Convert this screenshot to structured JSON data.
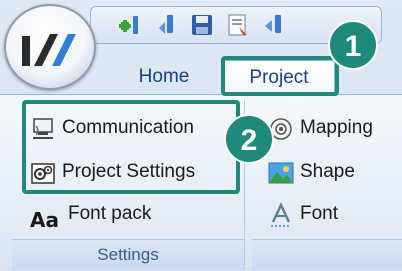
{
  "ribbon": {
    "tabs": [
      {
        "label": "Home"
      },
      {
        "label": "Project"
      }
    ],
    "settings_group": {
      "label": "Settings",
      "items": [
        {
          "label": "Communication",
          "icon": "communication-icon"
        },
        {
          "label": "Project Settings",
          "icon": "project-settings-icon"
        },
        {
          "label": "Font pack",
          "icon": "font-pack-icon"
        }
      ]
    },
    "right_group": {
      "items": [
        {
          "label": "Mapping",
          "icon": "mapping-icon"
        },
        {
          "label": "Shape",
          "icon": "shape-icon"
        },
        {
          "label": "Font",
          "icon": "font-icon"
        }
      ]
    },
    "font_pack_glyph": "Aa"
  },
  "callouts": [
    {
      "number": "1"
    },
    {
      "number": "2"
    }
  ],
  "colors": {
    "callout": "#1e8a7a",
    "tab_text": "#15428b"
  }
}
